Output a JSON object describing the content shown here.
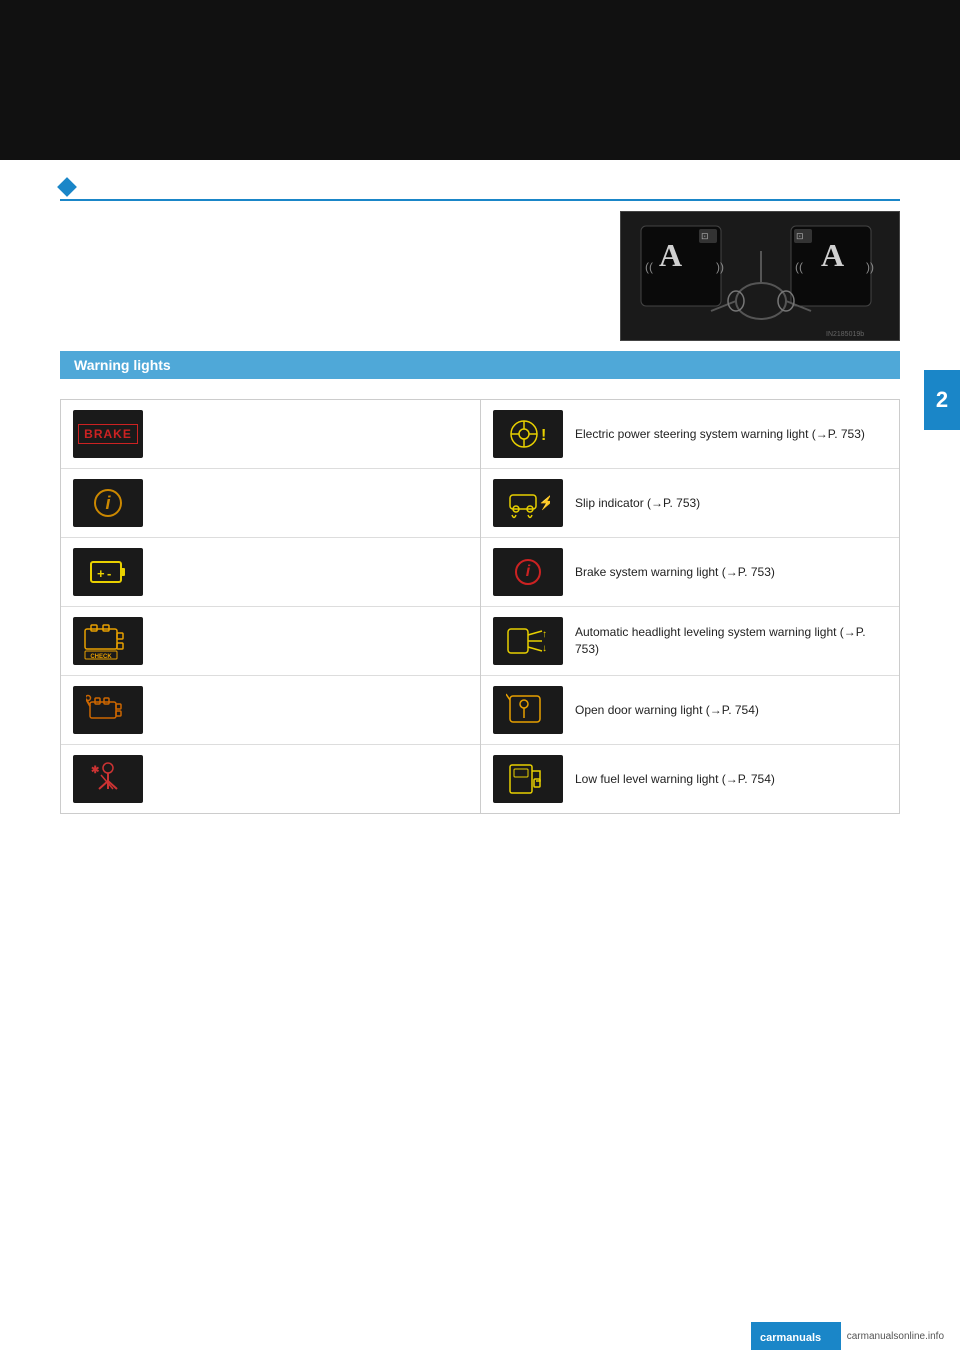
{
  "page": {
    "background_top_bar": "#111111",
    "chapter_number": "2",
    "chapter_color": "#1a86c8"
  },
  "section": {
    "title": "Warning lights",
    "header_bg": "#4fa8d8",
    "diamond_color": "#1a86c8"
  },
  "image": {
    "caption": "IN2185019b"
  },
  "left_icons": [
    {
      "id": "brake",
      "label": "BRAKE",
      "type": "brake",
      "description": ""
    },
    {
      "id": "circle-i-1",
      "label": "ⓘ",
      "type": "circle-i",
      "description": ""
    },
    {
      "id": "battery",
      "label": "🔋",
      "type": "battery",
      "description": ""
    },
    {
      "id": "check",
      "label": "CHECK",
      "type": "check",
      "description": ""
    },
    {
      "id": "engine",
      "label": "⚙",
      "type": "engine",
      "description": ""
    },
    {
      "id": "person",
      "label": "👤",
      "type": "person",
      "description": ""
    }
  ],
  "right_items": [
    {
      "id": "eps",
      "description": "Electric power steering system warning light (→P. 753)"
    },
    {
      "id": "slip",
      "description": "Slip indicator (→P. 753)"
    },
    {
      "id": "brake-sys",
      "description": "Brake system warning light (→P. 753)"
    },
    {
      "id": "headlight",
      "description": "Automatic headlight leveling system warning light (→P. 753)"
    },
    {
      "id": "open-door",
      "description": "Open door warning light (→P. 754)"
    },
    {
      "id": "fuel",
      "description": "Low fuel level warning light (→P. 754)"
    }
  ],
  "watermark": {
    "site": "carmanualsonline.info"
  }
}
